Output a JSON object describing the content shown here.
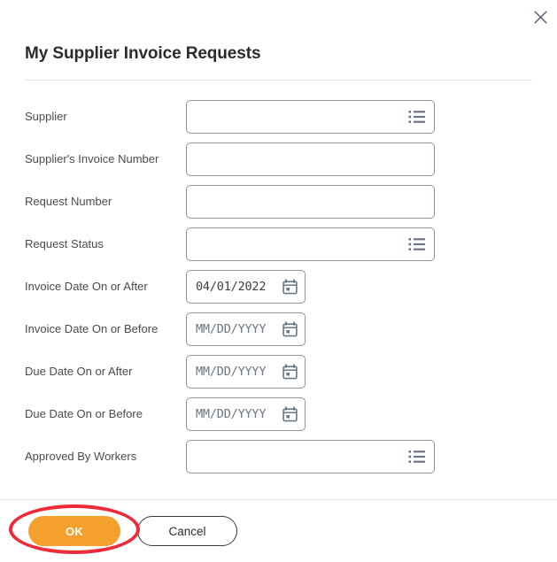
{
  "dialog": {
    "title": "My Supplier Invoice Requests",
    "close_icon": "close-icon",
    "close_label": "Close"
  },
  "colors": {
    "accent_orange": "#f5a02c",
    "annotation_red": "#ec2a3a",
    "field_border": "#8b95a5",
    "label_text": "#4b4b4b",
    "title_text": "#2b2b2b",
    "placeholder_text": "#6d7684",
    "divider": "#e3e3e3",
    "background": "#ffffff"
  },
  "form": {
    "fields": [
      {
        "id": "supplier",
        "label": "Supplier",
        "type": "prompt",
        "value": "",
        "placeholder": "",
        "icon": "prompt-list-icon"
      },
      {
        "id": "suppliers-invoice-number",
        "label": "Supplier's Invoice Number",
        "type": "text",
        "value": "",
        "placeholder": "",
        "icon": ""
      },
      {
        "id": "request-number",
        "label": "Request Number",
        "type": "text",
        "value": "",
        "placeholder": "",
        "icon": ""
      },
      {
        "id": "request-status",
        "label": "Request Status",
        "type": "prompt",
        "value": "",
        "placeholder": "",
        "icon": "prompt-list-icon"
      },
      {
        "id": "invoice-date-on-or-after",
        "label": "Invoice Date On or After",
        "type": "date",
        "value": "04/01/2022",
        "placeholder": "MM/DD/YYYY",
        "icon": "calendar-icon"
      },
      {
        "id": "invoice-date-on-or-before",
        "label": "Invoice Date On or Before",
        "type": "date",
        "value": "",
        "placeholder": "MM/DD/YYYY",
        "icon": "calendar-icon"
      },
      {
        "id": "due-date-on-or-after",
        "label": "Due Date On or After",
        "type": "date",
        "value": "",
        "placeholder": "MM/DD/YYYY",
        "icon": "calendar-icon"
      },
      {
        "id": "due-date-on-or-before",
        "label": "Due Date On or Before",
        "type": "date",
        "value": "",
        "placeholder": "MM/DD/YYYY",
        "icon": "calendar-icon"
      },
      {
        "id": "approved-by-workers",
        "label": "Approved By Workers",
        "type": "prompt",
        "value": "",
        "placeholder": "",
        "icon": "prompt-list-icon"
      }
    ]
  },
  "footer": {
    "ok_label": "OK",
    "cancel_label": "Cancel"
  }
}
